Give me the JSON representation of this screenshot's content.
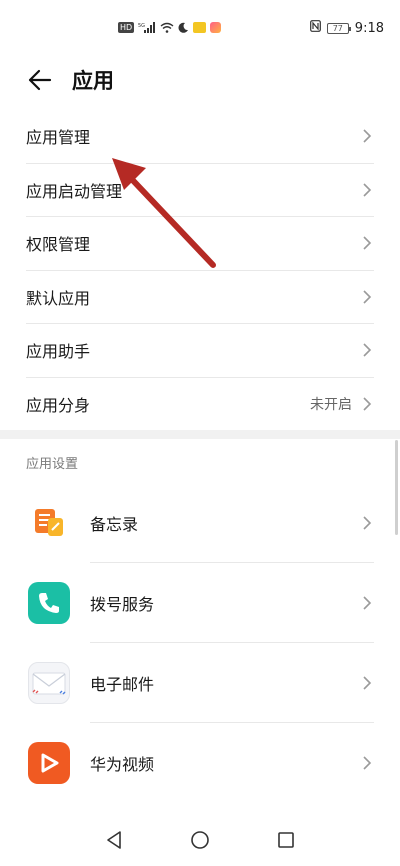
{
  "status_bar": {
    "time": "9:18",
    "battery": "77",
    "network": "5G",
    "hd": "HD"
  },
  "header": {
    "title": "应用"
  },
  "menu": {
    "items": [
      {
        "label": "应用管理",
        "value": ""
      },
      {
        "label": "应用启动管理",
        "value": ""
      },
      {
        "label": "权限管理",
        "value": ""
      },
      {
        "label": "默认应用",
        "value": ""
      },
      {
        "label": "应用助手",
        "value": ""
      },
      {
        "label": "应用分身",
        "value": "未开启"
      }
    ]
  },
  "section": {
    "title": "应用设置"
  },
  "apps": [
    {
      "label": "备忘录",
      "icon": "notepad-icon"
    },
    {
      "label": "拨号服务",
      "icon": "phone-icon"
    },
    {
      "label": "电子邮件",
      "icon": "envelope-icon"
    },
    {
      "label": "华为视频",
      "icon": "play-icon"
    }
  ],
  "colors": {
    "annotation_arrow": "#b52a24",
    "phone_icon": "#1bbfa5",
    "video_icon": "#f05a22",
    "notepad_icon": "#f49a1c"
  }
}
